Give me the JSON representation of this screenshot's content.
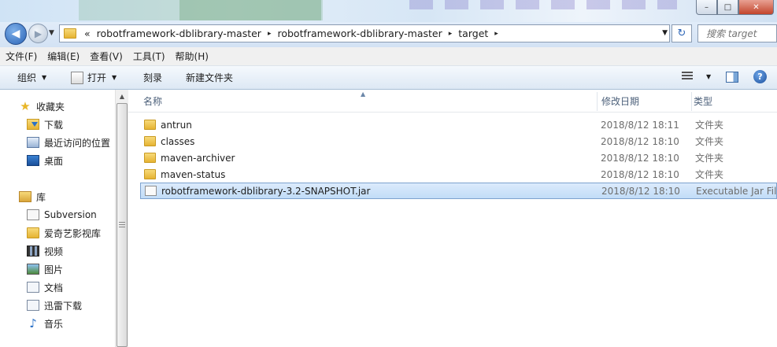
{
  "window": {
    "min_glyph": "–",
    "max_glyph": "□",
    "close_glyph": "✕"
  },
  "address": {
    "overflow": "«",
    "crumbs": [
      "robotframework-dblibrary-master",
      "robotframework-dblibrary-master",
      "target"
    ],
    "separator": "▸"
  },
  "search": {
    "placeholder": "搜索 target"
  },
  "menu": [
    "文件(F)",
    "编辑(E)",
    "查看(V)",
    "工具(T)",
    "帮助(H)"
  ],
  "toolbar": {
    "organize": "组织",
    "open": "打开",
    "burn": "刻录",
    "new_folder": "新建文件夹"
  },
  "nav": {
    "favorites": {
      "title": "收藏夹",
      "items": [
        "下载",
        "最近访问的位置",
        "桌面"
      ]
    },
    "libraries": {
      "title": "库",
      "items": [
        "Subversion",
        "爱奇艺影视库",
        "视频",
        "图片",
        "文档",
        "迅雷下载",
        "音乐"
      ]
    }
  },
  "columns": {
    "name": "名称",
    "modified": "修改日期",
    "type": "类型"
  },
  "files": [
    {
      "name": "antrun",
      "date": "2018/8/12 18:11",
      "type": "文件夹",
      "kind": "folder"
    },
    {
      "name": "classes",
      "date": "2018/8/12 18:10",
      "type": "文件夹",
      "kind": "folder"
    },
    {
      "name": "maven-archiver",
      "date": "2018/8/12 18:10",
      "type": "文件夹",
      "kind": "folder"
    },
    {
      "name": "maven-status",
      "date": "2018/8/12 18:10",
      "type": "文件夹",
      "kind": "folder"
    },
    {
      "name": "robotframework-dblibrary-3.2-SNAPSHOT.jar",
      "date": "2018/8/12 18:10",
      "type": "Executable Jar File",
      "kind": "jar",
      "selected": true
    }
  ]
}
